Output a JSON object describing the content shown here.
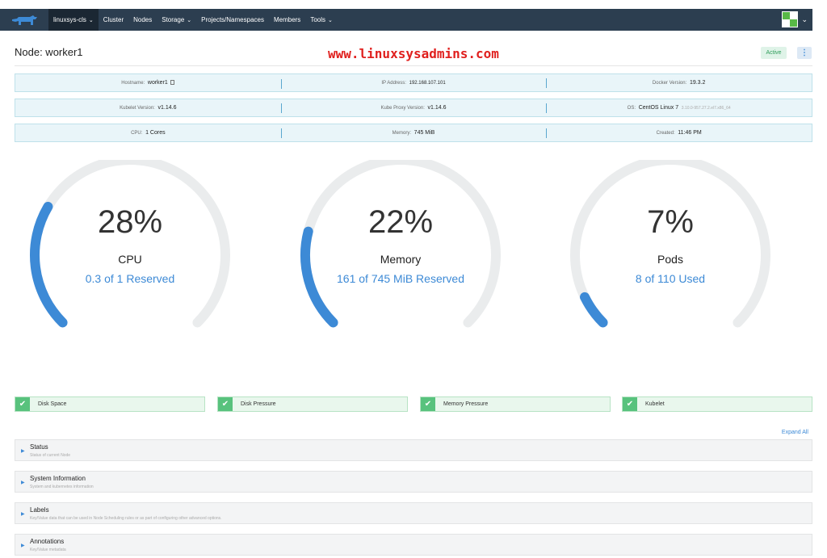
{
  "nav": {
    "cluster_selector": "linuxsys-cls",
    "items": [
      {
        "label": "Cluster",
        "dropdown": false
      },
      {
        "label": "Nodes",
        "dropdown": false
      },
      {
        "label": "Storage",
        "dropdown": true
      },
      {
        "label": "Projects/Namespaces",
        "dropdown": false
      },
      {
        "label": "Members",
        "dropdown": false
      },
      {
        "label": "Tools",
        "dropdown": true
      }
    ],
    "caret": "⌄"
  },
  "header": {
    "title": "Node: worker1",
    "watermark": "www.linuxsysadmins.com",
    "status": "Active",
    "menu": "⋮"
  },
  "info": {
    "row1": {
      "hostname_label": "Hostname:",
      "hostname": "worker1",
      "ip_label": "IP Address:",
      "ip": "192.168.107.101",
      "docker_label": "Docker Version:",
      "docker": "19.3.2"
    },
    "row2": {
      "kubelet_label": "Kubelet Version:",
      "kubelet": "v1.14.6",
      "proxy_label": "Kube Proxy Version:",
      "proxy": "v1.14.6",
      "os_label": "OS:",
      "os": "CentOS Linux 7",
      "kernel": "3.10.0-957.27.2.el7.x86_64"
    },
    "row3": {
      "cpu_label": "CPU:",
      "cpu": "1 Cores",
      "memory_label": "Memory:",
      "memory": "745 MiB",
      "created_label": "Created:",
      "created": "11:46 PM"
    }
  },
  "gauges": [
    {
      "percent": "28%",
      "label": "CPU",
      "detail": "0.3 of 1 Reserved",
      "fraction": 0.28
    },
    {
      "percent": "22%",
      "label": "Memory",
      "detail": "161 of 745 MiB Reserved",
      "fraction": 0.22
    },
    {
      "percent": "7%",
      "label": "Pods",
      "detail": "8 of 110 Used",
      "fraction": 0.07
    }
  ],
  "conditions": [
    "Disk Space",
    "Disk Pressure",
    "Memory Pressure",
    "Kubelet"
  ],
  "expand_all": "Expand All",
  "sections": [
    {
      "title": "Status",
      "desc": "Status of current Node"
    },
    {
      "title": "System Information",
      "desc": "System and kubernetes information"
    },
    {
      "title": "Labels",
      "desc": "Key/Value data that can be used in Node Scheduling rules or as part of configuring other advanced options."
    },
    {
      "title": "Annotations",
      "desc": "Key/Value metadata"
    }
  ],
  "colors": {
    "accent": "#3d8ad6",
    "navbar": "#2c3e50",
    "gauge_track": "#eaeced",
    "gauge_fill": "#3d8ad6",
    "ok": "#58c27d"
  }
}
